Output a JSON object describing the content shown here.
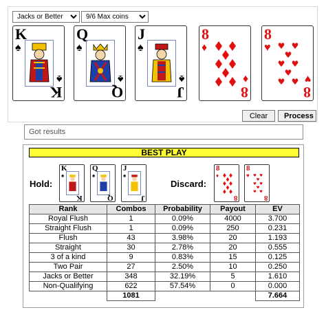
{
  "game_select": {
    "value": "Jacks or Better",
    "options": [
      "Jacks or Better"
    ]
  },
  "pay_select": {
    "value": "9/6 Max coins",
    "options": [
      "9/6 Max coins"
    ]
  },
  "cards": [
    {
      "rank": "K",
      "suit": "♠",
      "color": "#000000",
      "name": "king-of-spades"
    },
    {
      "rank": "Q",
      "suit": "♠",
      "color": "#000000",
      "name": "queen-of-spades"
    },
    {
      "rank": "J",
      "suit": "♠",
      "color": "#000000",
      "name": "jack-of-spades"
    },
    {
      "rank": "8",
      "suit": "♦",
      "color": "#e01010",
      "name": "eight-of-diamonds"
    },
    {
      "rank": "8",
      "suit": "♥",
      "color": "#e01010",
      "name": "eight-of-hearts"
    }
  ],
  "buttons": {
    "clear": "Clear",
    "process": "Process"
  },
  "results_text": "Got results",
  "best_play": {
    "title": "BEST PLAY",
    "hold_label": "Hold:",
    "discard_label": "Discard:",
    "highlight_color": "#ffff33"
  },
  "table": {
    "headers": [
      "Rank",
      "Combos",
      "Probability",
      "Payout",
      "EV"
    ],
    "rows": [
      [
        "Royal Flush",
        "1",
        "0.09%",
        "4000",
        "3.700"
      ],
      [
        "Straight Flush",
        "1",
        "0.09%",
        "250",
        "0.231"
      ],
      [
        "Flush",
        "43",
        "3.98%",
        "20",
        "1.193"
      ],
      [
        "Straight",
        "30",
        "2.78%",
        "20",
        "0.555"
      ],
      [
        "3 of a kind",
        "9",
        "0.83%",
        "15",
        "0.125"
      ],
      [
        "Two Pair",
        "27",
        "2.50%",
        "10",
        "0.250"
      ],
      [
        "Jacks or Better",
        "348",
        "32.19%",
        "5",
        "1.610"
      ],
      [
        "Non-Qualifying",
        "622",
        "57.54%",
        "0",
        "0.000"
      ]
    ],
    "total_combos": "1081",
    "total_ev": "7.664"
  }
}
